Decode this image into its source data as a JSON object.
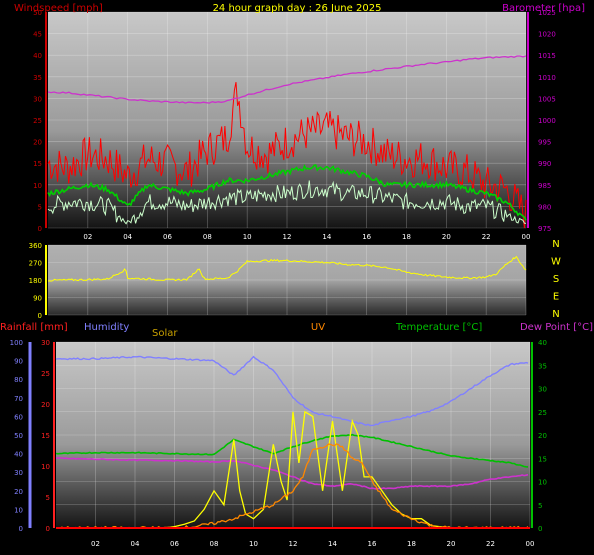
{
  "header": {
    "title": "24 hour graph day : 26 June 2025",
    "wind_axis_label": "Windspeed [mph]",
    "baro_axis_label": "Barometer [hpa]"
  },
  "colors": {
    "wind_gust": "#ff0000",
    "wind_avg": "#00d000",
    "wind_speed": "#ccffcc",
    "barometer": "#cc33cc",
    "direction": "#ffff00",
    "humidity": "#8080ff",
    "temperature": "#00c000",
    "dew_point": "#cc33cc",
    "solar": "#ffff00",
    "uv": "#ff8800",
    "rainfall": "#ff0000",
    "left_axis": "#cc0000",
    "right_axis": "#cc00cc",
    "temp_axis": "#00c000",
    "humidity_axis": "#8080ff"
  },
  "chart_data": [
    {
      "type": "line",
      "name": "wind_and_barometer",
      "x_label_ticks": [
        "02",
        "04",
        "06",
        "08",
        "10",
        "12",
        "14",
        "16",
        "18",
        "20",
        "22",
        "00"
      ],
      "x_range_hours": [
        0,
        24
      ],
      "left_axis": {
        "label": "Windspeed [mph]",
        "ylim": [
          0,
          50
        ],
        "ticks": [
          0,
          5,
          10,
          15,
          20,
          25,
          30,
          35,
          40,
          45,
          50
        ]
      },
      "right_axis": {
        "label": "Barometer [hpa]",
        "ylim": [
          975,
          1025
        ],
        "ticks": [
          975,
          980,
          985,
          990,
          995,
          1000,
          1005,
          1010,
          1015,
          1020,
          1025
        ]
      },
      "series": [
        {
          "key": "gust",
          "axis": "left",
          "hours": [
            0,
            1,
            2,
            3,
            4,
            5,
            6,
            7,
            8,
            9,
            9.5,
            10,
            11,
            12,
            13,
            14,
            15,
            16,
            17,
            18,
            19,
            20,
            21,
            22,
            23,
            24
          ],
          "values": [
            15,
            14,
            17,
            16,
            12,
            16,
            15,
            13,
            18,
            21,
            32,
            19,
            17,
            20,
            22,
            23,
            21,
            20,
            17,
            16,
            16,
            14,
            13,
            10,
            9,
            3
          ]
        },
        {
          "key": "average",
          "axis": "left",
          "hours": [
            0,
            1,
            2,
            3,
            4,
            5,
            6,
            7,
            8,
            9,
            10,
            11,
            12,
            13,
            14,
            15,
            16,
            17,
            18,
            19,
            20,
            21,
            22,
            23,
            24
          ],
          "values": [
            8,
            9,
            10,
            9,
            5,
            10,
            9,
            8,
            9,
            11,
            11,
            12,
            13,
            14,
            14,
            13,
            12,
            10,
            10,
            10,
            10,
            9,
            8,
            6,
            2
          ]
        },
        {
          "key": "speed",
          "axis": "left",
          "hours": [
            0,
            1,
            2,
            3,
            4,
            5,
            6,
            7,
            8,
            9,
            10,
            11,
            12,
            13,
            14,
            15,
            16,
            17,
            18,
            19,
            20,
            21,
            22,
            23,
            24
          ],
          "values": [
            5,
            6,
            6,
            5,
            1,
            6,
            6,
            5,
            6,
            7,
            7,
            8,
            8,
            9,
            9,
            8,
            8,
            7,
            6,
            6,
            6,
            5,
            5,
            3,
            1
          ]
        },
        {
          "key": "barometer",
          "axis": "right",
          "hours": [
            0,
            1,
            2,
            3,
            4,
            5,
            6,
            7,
            8,
            9,
            10,
            11,
            12,
            13,
            14,
            15,
            16,
            17,
            18,
            19,
            20,
            21,
            22,
            23,
            24
          ],
          "values": [
            1006.5,
            1006.3,
            1005.8,
            1005.3,
            1004.8,
            1004.4,
            1004.2,
            1004,
            1004,
            1004.4,
            1005.8,
            1007,
            1008.2,
            1009,
            1009.8,
            1010.6,
            1011.2,
            1011.8,
            1012.4,
            1013,
            1013.4,
            1014,
            1014.4,
            1014.6,
            1014.8
          ]
        }
      ]
    },
    {
      "type": "line",
      "name": "wind_direction",
      "left_axis": {
        "ylim": [
          0,
          360
        ],
        "ticks": [
          0,
          90,
          180,
          270,
          360
        ]
      },
      "right_axis": {
        "labels": [
          "N",
          "W",
          "S",
          "E",
          "N"
        ]
      },
      "x_label_ticks": [
        "02",
        "04",
        "06",
        "08",
        "10",
        "12",
        "14",
        "16",
        "18",
        "20",
        "22",
        "00"
      ],
      "series": [
        {
          "key": "direction",
          "hours": [
            0,
            1,
            2,
            3,
            3.9,
            4,
            5,
            6,
            7,
            7.6,
            7.8,
            8,
            9,
            9.5,
            10,
            11,
            12,
            13,
            14,
            15,
            16,
            17,
            18,
            19,
            20,
            21,
            22,
            22.5,
            23,
            23.5,
            24
          ],
          "values": [
            178,
            180,
            182,
            185,
            235,
            190,
            185,
            180,
            183,
            240,
            190,
            185,
            190,
            225,
            275,
            280,
            280,
            275,
            270,
            260,
            255,
            245,
            220,
            205,
            195,
            190,
            195,
            210,
            260,
            300,
            230
          ]
        }
      ]
    },
    {
      "type": "line",
      "name": "temperature_humidity_solar",
      "axes": [
        {
          "key": "rainfall",
          "label": "Rainfall [mm]",
          "ylim": [
            0,
            30
          ],
          "ticks": [
            0,
            5,
            10,
            15,
            20,
            25,
            30
          ]
        },
        {
          "key": "humidity",
          "label": "Humidity",
          "ylim": [
            0,
            100
          ],
          "ticks": [
            0,
            10,
            20,
            30,
            40,
            50,
            60,
            70,
            80,
            90,
            100
          ]
        },
        {
          "key": "temperature",
          "label": "Temperature [°C]",
          "ylim": [
            0,
            40
          ],
          "ticks": [
            0,
            5,
            10,
            15,
            20,
            25,
            30,
            35,
            40
          ]
        },
        {
          "key": "dew_point",
          "label": "Dew Point [°C]",
          "ylim": [
            0,
            40
          ],
          "ticks": [
            0,
            5,
            10,
            15,
            20,
            25,
            30,
            35,
            40
          ]
        }
      ],
      "legend_labels": {
        "solar": "Solar",
        "uv": "UV"
      },
      "x_label_ticks": [
        "02",
        "04",
        "06",
        "08",
        "10",
        "12",
        "14",
        "16",
        "18",
        "20",
        "22",
        "00"
      ],
      "series": [
        {
          "key": "humidity",
          "axis": "humidity",
          "hours": [
            0,
            2,
            4,
            6,
            8,
            9,
            10,
            11,
            12,
            13,
            14,
            15,
            16,
            17,
            18,
            19,
            20,
            21,
            22,
            23,
            24
          ],
          "values": [
            91,
            91,
            92,
            91,
            90,
            82,
            92,
            85,
            70,
            62,
            60,
            57,
            55,
            58,
            60,
            63,
            68,
            75,
            82,
            88,
            89
          ]
        },
        {
          "key": "temperature",
          "axis": "temperature",
          "hours": [
            0,
            2,
            4,
            6,
            8,
            9,
            10,
            11,
            12,
            13,
            14,
            15,
            16,
            17,
            18,
            19,
            20,
            21,
            22,
            23,
            24
          ],
          "values": [
            16,
            16.2,
            16.2,
            16,
            15.8,
            19,
            17.5,
            16,
            17.5,
            18.8,
            19.8,
            20,
            19.5,
            18.5,
            17.5,
            16.5,
            15.5,
            15,
            14.5,
            14,
            13
          ]
        },
        {
          "key": "dew_point",
          "axis": "dew_point",
          "hours": [
            0,
            2,
            4,
            6,
            8,
            9,
            10,
            11,
            12,
            13,
            14,
            15,
            16,
            17,
            18,
            19,
            20,
            21,
            22,
            23,
            24
          ],
          "values": [
            15,
            14.8,
            14.6,
            14.5,
            14.2,
            14.5,
            13.5,
            12.5,
            11,
            9.5,
            9,
            9.5,
            8.5,
            8.5,
            9,
            9,
            9,
            9.5,
            10.5,
            11,
            11.5
          ]
        },
        {
          "key": "solar",
          "axis": "temperature",
          "hours": [
            0,
            5.5,
            6,
            6.5,
            7,
            7.5,
            8,
            8.5,
            9,
            9.3,
            9.6,
            10,
            10.5,
            11,
            11.4,
            11.7,
            12,
            12.3,
            12.6,
            13,
            13.5,
            14,
            14.5,
            15,
            15.3,
            15.6,
            16,
            16.5,
            17,
            17.5,
            18,
            18.5,
            19,
            20,
            21,
            24
          ],
          "values": [
            0,
            0,
            0.3,
            0.8,
            1.5,
            4,
            8,
            5,
            19,
            8,
            3,
            2,
            4,
            18,
            10,
            6,
            25,
            14,
            25,
            24,
            8,
            23,
            8,
            23,
            20,
            11,
            11,
            8,
            5,
            3,
            2,
            2,
            0.5,
            0,
            0,
            0
          ]
        },
        {
          "key": "uv",
          "axis": "temperature",
          "hours": [
            0,
            6,
            7,
            8,
            9,
            10,
            11,
            12,
            12.5,
            13,
            14,
            14.5,
            15,
            15.5,
            16,
            16.5,
            17,
            18,
            19,
            20,
            24
          ],
          "values": [
            0,
            0,
            0.3,
            1,
            2,
            3.5,
            5,
            8,
            11,
            17,
            18,
            17.5,
            15,
            14,
            10,
            7,
            4,
            2,
            0.5,
            0,
            0
          ]
        },
        {
          "key": "rainfall",
          "axis": "rainfall",
          "hours": [
            0,
            24
          ],
          "values": [
            0,
            0
          ]
        }
      ]
    }
  ]
}
